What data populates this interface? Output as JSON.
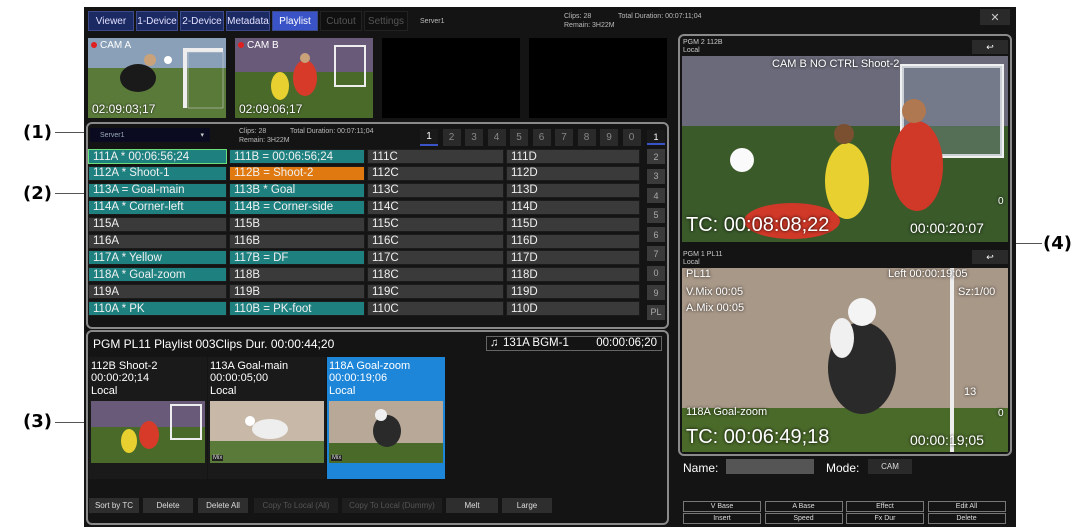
{
  "callouts": [
    "(1)",
    "(2)",
    "(3)",
    "(4)"
  ],
  "tabs": [
    {
      "label": "Viewer",
      "state": "normal"
    },
    {
      "label": "1-Device",
      "state": "normal"
    },
    {
      "label": "2-Device",
      "state": "normal"
    },
    {
      "label": "Metadata",
      "state": "normal"
    },
    {
      "label": "Playlist",
      "state": "active"
    },
    {
      "label": "Cutout",
      "state": "disabled"
    },
    {
      "label": "Settings",
      "state": "disabled"
    }
  ],
  "header": {
    "server": "Server1",
    "clips": "Clips: 28",
    "remain": "Remain: 3H22M",
    "total": "Total Duration: 00:07:11;04",
    "close": "✕"
  },
  "cameras": [
    {
      "label": "CAM A",
      "tc": "02:09:03;17"
    },
    {
      "label": "CAM B",
      "tc": "02:09:06;17"
    }
  ],
  "clip_panel": {
    "server_select": "Server1",
    "clips": "Clips: 28",
    "total": "Total Duration: 00:07:11;04",
    "remain": "Remain: 3H22M",
    "pages": [
      "1",
      "2",
      "3",
      "4",
      "5",
      "6",
      "7",
      "8",
      "9",
      "0"
    ],
    "active_page": "1",
    "side_buttons": [
      "1",
      "2",
      "3",
      "4",
      "5",
      "6",
      "7",
      "0",
      "9",
      "PL"
    ],
    "columns": [
      [
        {
          "text": "111A  * 00:06:56;24",
          "color": "#1f8080",
          "selected": true
        },
        {
          "text": "112A  * Shoot-1",
          "color": "#1f8080"
        },
        {
          "text": "113A  = Goal-main",
          "color": "#1f8080"
        },
        {
          "text": "114A  * Corner-left",
          "color": "#1f8080"
        },
        {
          "text": "115A",
          "color": "#3a3a3a"
        },
        {
          "text": "116A",
          "color": "#3a3a3a"
        },
        {
          "text": "117A  * Yellow",
          "color": "#1f8080"
        },
        {
          "text": "118A  * Goal-zoom",
          "color": "#1f8080"
        },
        {
          "text": "119A",
          "color": "#3a3a3a"
        },
        {
          "text": "110A  * PK",
          "color": "#1f8080"
        }
      ],
      [
        {
          "text": "111B  = 00:06:56;24",
          "color": "#1f8080"
        },
        {
          "text": "112B  = Shoot-2",
          "color": "#e07a10"
        },
        {
          "text": "113B  * Goal",
          "color": "#1f8080"
        },
        {
          "text": "114B  = Corner-side",
          "color": "#1f8080"
        },
        {
          "text": "115B",
          "color": "#3a3a3a"
        },
        {
          "text": "116B",
          "color": "#3a3a3a"
        },
        {
          "text": "117B  = DF",
          "color": "#1f8080"
        },
        {
          "text": "118B",
          "color": "#3a3a3a"
        },
        {
          "text": "119B",
          "color": "#3a3a3a"
        },
        {
          "text": "110B  = PK-foot",
          "color": "#1f8080"
        }
      ],
      [
        {
          "text": "111C",
          "color": "#3a3a3a"
        },
        {
          "text": "112C",
          "color": "#3a3a3a"
        },
        {
          "text": "113C",
          "color": "#3a3a3a"
        },
        {
          "text": "114C",
          "color": "#3a3a3a"
        },
        {
          "text": "115C",
          "color": "#3a3a3a"
        },
        {
          "text": "116C",
          "color": "#3a3a3a"
        },
        {
          "text": "117C",
          "color": "#3a3a3a"
        },
        {
          "text": "118C",
          "color": "#3a3a3a"
        },
        {
          "text": "119C",
          "color": "#3a3a3a"
        },
        {
          "text": "110C",
          "color": "#3a3a3a"
        }
      ],
      [
        {
          "text": "111D",
          "color": "#3a3a3a"
        },
        {
          "text": "112D",
          "color": "#3a3a3a"
        },
        {
          "text": "113D",
          "color": "#3a3a3a"
        },
        {
          "text": "114D",
          "color": "#3a3a3a"
        },
        {
          "text": "115D",
          "color": "#3a3a3a"
        },
        {
          "text": "116D",
          "color": "#3a3a3a"
        },
        {
          "text": "117D",
          "color": "#3a3a3a"
        },
        {
          "text": "118D",
          "color": "#3a3a3a"
        },
        {
          "text": "119D",
          "color": "#3a3a3a"
        },
        {
          "text": "110D",
          "color": "#3a3a3a"
        }
      ]
    ]
  },
  "playlist": {
    "header": "PGM   PL11   Playlist   003Clips   Dur.  00:00:44;20",
    "bgm_clip": "131A  BGM-1",
    "bgm_dur": "00:00:06;20",
    "cards": [
      {
        "title": "112B Shoot-2",
        "tc": "00:00:20;14",
        "src": "Local",
        "mix": "",
        "selected": false
      },
      {
        "title": "113A Goal-main",
        "tc": "00:00:05;00",
        "src": "Local",
        "mix": "Mix",
        "selected": false
      },
      {
        "title": "118A Goal-zoom",
        "tc": "00:00:19;06",
        "src": "Local",
        "mix": "Mix",
        "selected": true
      }
    ],
    "buttons": [
      {
        "label": "Sort by TC",
        "disabled": false
      },
      {
        "label": "Delete",
        "disabled": false
      },
      {
        "label": "Delete All",
        "disabled": false
      },
      {
        "label": "Copy To Local (All)",
        "disabled": true
      },
      {
        "label": "Copy To Local (Dummy)",
        "disabled": true
      },
      {
        "label": "Melt",
        "disabled": false
      },
      {
        "label": "Large",
        "disabled": false
      }
    ]
  },
  "monitor_top": {
    "hdr1": "PGM 2   112B",
    "hdr2": "Local",
    "overlay_top": "CAM B    NO CTRL          Shoot-2",
    "tc": "TC: 00:08:08;22",
    "dur": "00:00:20:07",
    "zero": "0"
  },
  "monitor_bottom": {
    "hdr1": "PGM 1   PL11",
    "hdr2": "Local",
    "l1": "PL11",
    "l2": "V.Mix 00:05",
    "l3": "A.Mix 00:05",
    "left": "Left 00:00:19;05",
    "right": "Sz:1/00",
    "clip": "118A Goal-zoom",
    "tc": "TC: 00:06:49;18",
    "dur": "00:00:19;05",
    "n13": "13",
    "zero": "0"
  },
  "bottom_right": {
    "name_label": "Name:",
    "mode_label": "Mode:",
    "mode_value": "CAM",
    "buttons": [
      "V Base",
      "A Base",
      "Effect",
      "Edit All",
      "Insert",
      "Speed",
      "Fx Dur",
      "Delete"
    ]
  }
}
